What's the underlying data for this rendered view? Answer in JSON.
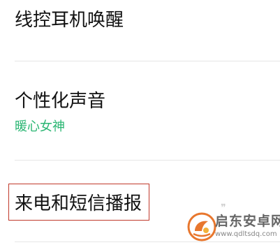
{
  "settings": {
    "items": [
      {
        "title": "线控耳机唤醒"
      },
      {
        "title": "个性化声音",
        "subtitle": "暖心女神"
      },
      {
        "title": "来电和短信播报"
      }
    ]
  },
  "watermark": {
    "name": "启东安卓网",
    "url": "www.qdltsdq.com"
  },
  "colors": {
    "subtitle_accent": "#2bb673",
    "highlight_border": "#c0392b"
  }
}
